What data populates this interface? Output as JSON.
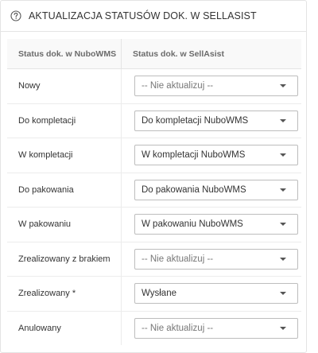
{
  "header": {
    "title": "AKTUALIZACJA STATUSÓW DOK. W SELLASIST"
  },
  "table": {
    "columns": {
      "source": "Status dok. w NuboWMS",
      "target": "Status dok. w SellAsist"
    },
    "rows": [
      {
        "label": "Nowy",
        "value": "-- Nie aktualizuj --"
      },
      {
        "label": "Do kompletacji",
        "value": "Do kompletacji NuboWMS"
      },
      {
        "label": "W kompletacji",
        "value": "W kompletacji NuboWMS"
      },
      {
        "label": "Do pakowania",
        "value": "Do pakowania NuboWMS"
      },
      {
        "label": "W pakowaniu",
        "value": "W pakowaniu NuboWMS"
      },
      {
        "label": "Zrealizowany z brakiem",
        "value": "-- Nie aktualizuj --"
      },
      {
        "label": "Zrealizowany *",
        "value": "Wysłane"
      },
      {
        "label": "Anulowany",
        "value": "-- Nie aktualizuj --"
      }
    ]
  },
  "icons": {
    "help": "help-circle-icon",
    "dropdown": "chevron-down-icon"
  },
  "colors": {
    "border": "#e4e4e4",
    "header_bg": "#f9f9f9",
    "text": "#333333",
    "muted": "#6b6b6b"
  }
}
